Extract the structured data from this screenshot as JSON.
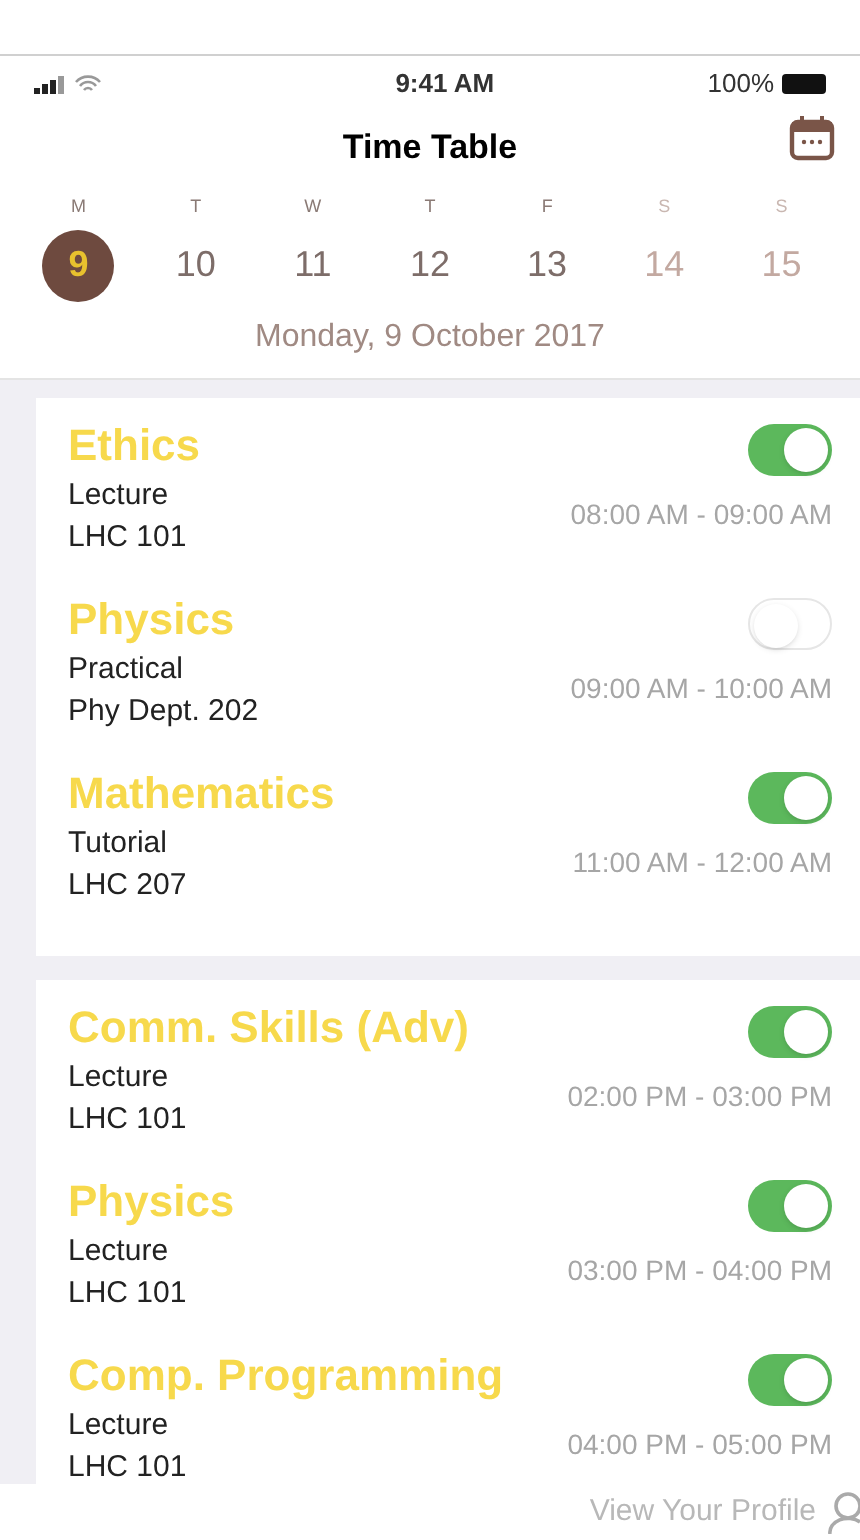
{
  "status_bar": {
    "time": "9:41 AM",
    "battery": "100%"
  },
  "header": {
    "title": "Time Table"
  },
  "week": [
    {
      "letter": "M",
      "day": "9",
      "selected": true,
      "weekend": false
    },
    {
      "letter": "T",
      "day": "10",
      "selected": false,
      "weekend": false
    },
    {
      "letter": "W",
      "day": "11",
      "selected": false,
      "weekend": false
    },
    {
      "letter": "T",
      "day": "12",
      "selected": false,
      "weekend": false
    },
    {
      "letter": "F",
      "day": "13",
      "selected": false,
      "weekend": false
    },
    {
      "letter": "S",
      "day": "14",
      "selected": false,
      "weekend": true
    },
    {
      "letter": "S",
      "day": "15",
      "selected": false,
      "weekend": true
    }
  ],
  "date": "Monday, 9 October 2017",
  "cards": [
    {
      "sessions": [
        {
          "title": "Ethics",
          "type": "Lecture",
          "room": "LHC 101",
          "time": "08:00 AM - 09:00 AM",
          "on": true
        },
        {
          "title": "Physics",
          "type": "Practical",
          "room": "Phy Dept. 202",
          "time": "09:00 AM - 10:00 AM",
          "on": false
        },
        {
          "title": "Mathematics",
          "type": "Tutorial",
          "room": "LHC 207",
          "time": "11:00 AM - 12:00 AM",
          "on": true
        }
      ]
    },
    {
      "sessions": [
        {
          "title": "Comm. Skills (Adv)",
          "type": "Lecture",
          "room": "LHC 101",
          "time": "02:00 PM - 03:00 PM",
          "on": true
        },
        {
          "title": "Physics",
          "type": "Lecture",
          "room": "LHC 101",
          "time": "03:00 PM - 04:00 PM",
          "on": true
        },
        {
          "title": "Comp. Programming",
          "type": "Lecture",
          "room": "LHC 101",
          "time": "04:00 PM - 05:00 PM",
          "on": true
        }
      ]
    }
  ],
  "footer": {
    "link": "View Your Profile"
  }
}
